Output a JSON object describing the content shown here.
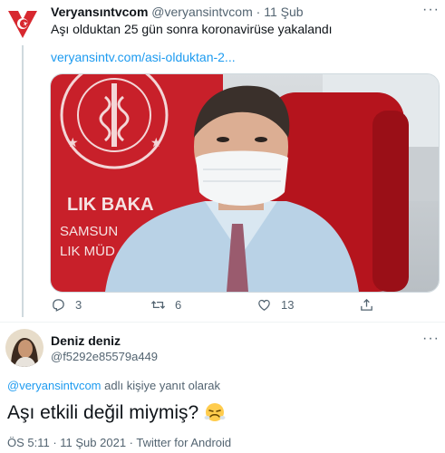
{
  "tweet": {
    "display_name": "Veryansıntvcom",
    "handle": "@veryansintvcom",
    "separator": "·",
    "date": "11 Şub",
    "text": "Aşı olduktan 25 gün sonra koronavirüse yakalandı",
    "link": "veryansintv.com/asi-olduktan-2...",
    "more": "···",
    "media_sign_lines": [
      "LIK BAKA",
      "SAMSUN",
      "LIK MÜD"
    ],
    "actions": {
      "reply_count": "3",
      "retweet_count": "6",
      "like_count": "13"
    }
  },
  "reply": {
    "display_name": "Deniz deniz",
    "handle": "@f5292e85579a449",
    "more": "···",
    "replying_to_mention": "@veryansintvcom",
    "replying_to_suffix": " adlı kişiye yanıt olarak",
    "text": "Aşı etkili değil miymiş?",
    "emoji": "face-with-steam-from-nose",
    "meta": "ÖS 5:11 · 11 Şub 2021 · Twitter for Android"
  },
  "colors": {
    "accent": "#1d9bf0",
    "secondary_text": "#536471",
    "brand_red": "#d7282f"
  }
}
